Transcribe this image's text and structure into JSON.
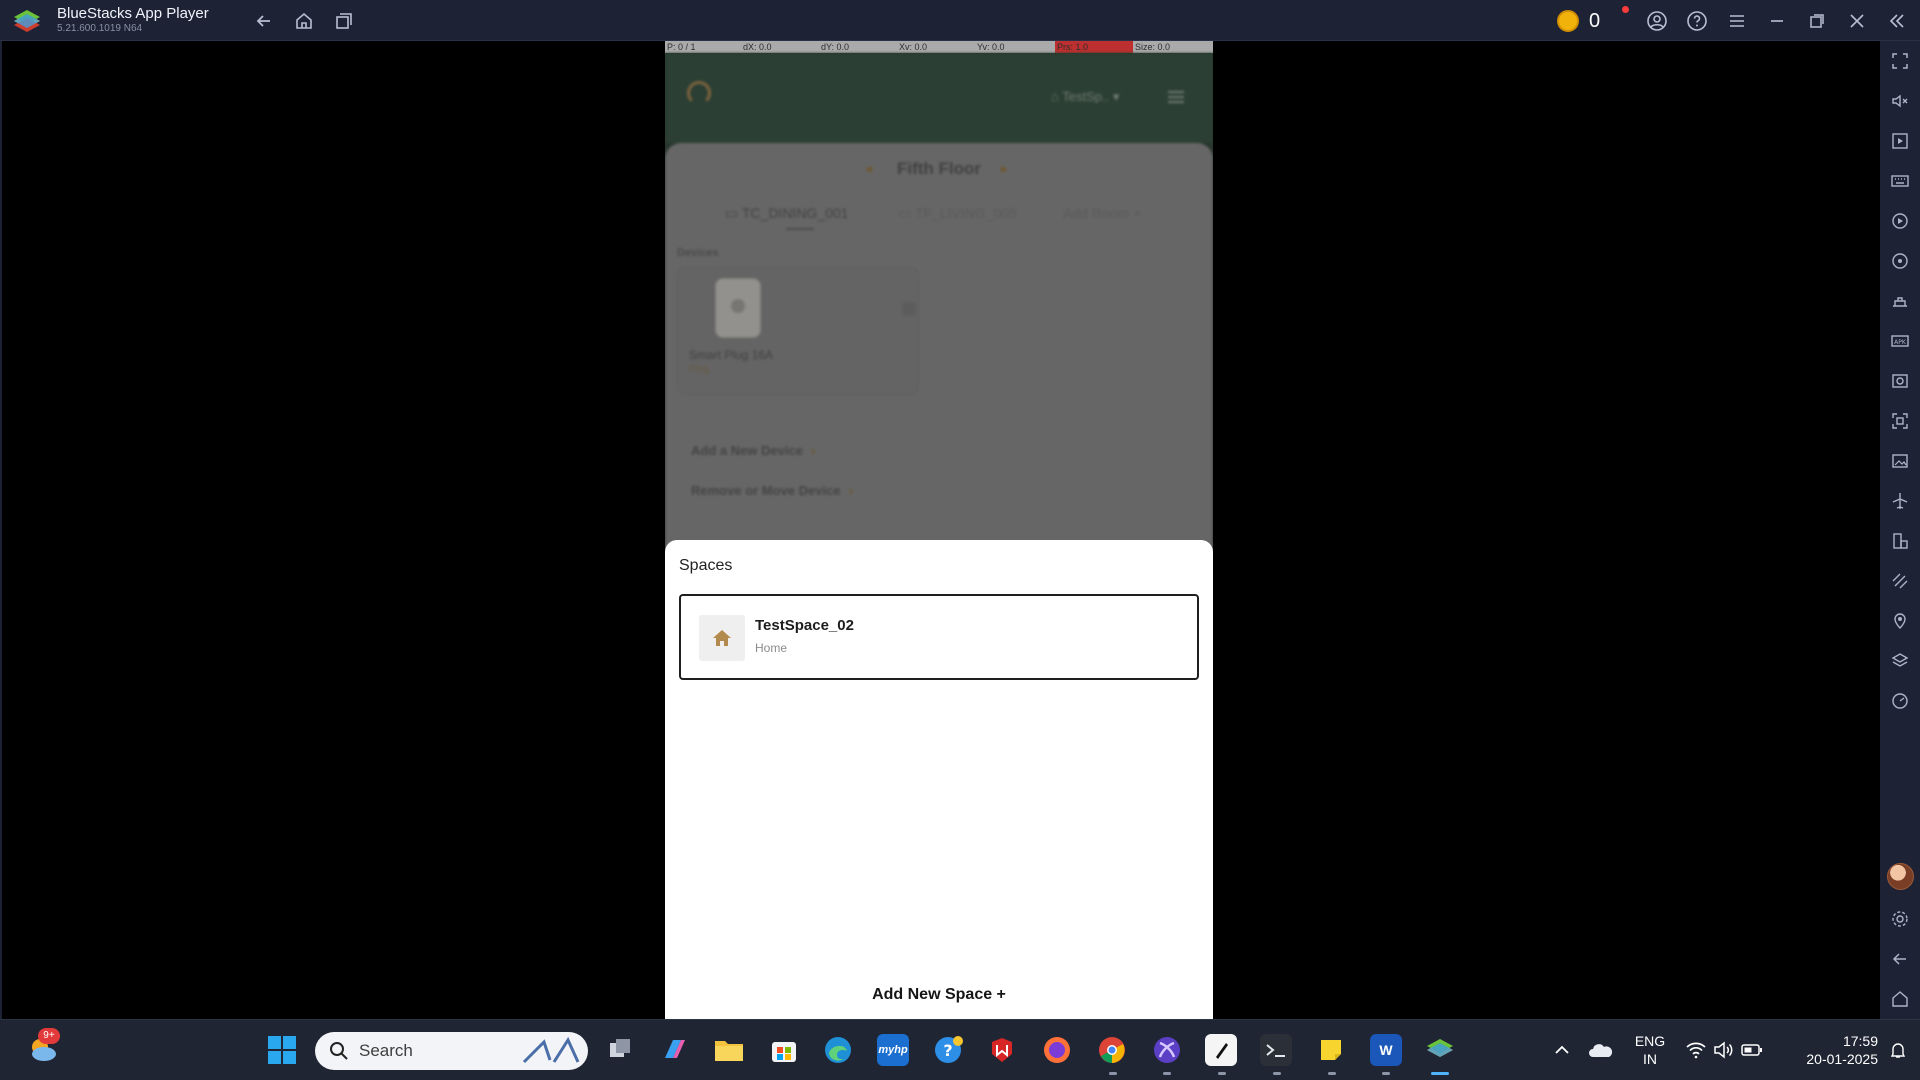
{
  "window": {
    "title": "BlueStacks App Player",
    "version": "5.21.600.1019  N64",
    "coins": "0"
  },
  "debug": {
    "p": "P: 0 / 1",
    "dx": "dX: 0.0",
    "dy": "dY: 0.0",
    "xv": "Xv: 0.0",
    "yv": "Yv: 0.0",
    "prs": "Prs: 1.0",
    "size": "Size: 0.0"
  },
  "app": {
    "space_pill": "TestSp..",
    "floor": "Fifth Floor",
    "rooms": [
      "TC_DINING_001",
      "TF_LIVING_005",
      "Add Room +"
    ],
    "devices_label": "Devices",
    "device": {
      "name": "Smart Plug 16A",
      "type": "Plug"
    },
    "actions": [
      "Add a New Device",
      "Remove or Move Device"
    ]
  },
  "sheet": {
    "title": "Spaces",
    "spaces": [
      {
        "name": "TestSpace_02",
        "type": "Home"
      }
    ],
    "add_label": "Add New Space +"
  },
  "taskbar": {
    "search_placeholder": "Search",
    "weather_badge": "9+",
    "lang_line1": "ENG",
    "lang_line2": "IN",
    "time": "17:59",
    "date": "20-01-2025"
  }
}
